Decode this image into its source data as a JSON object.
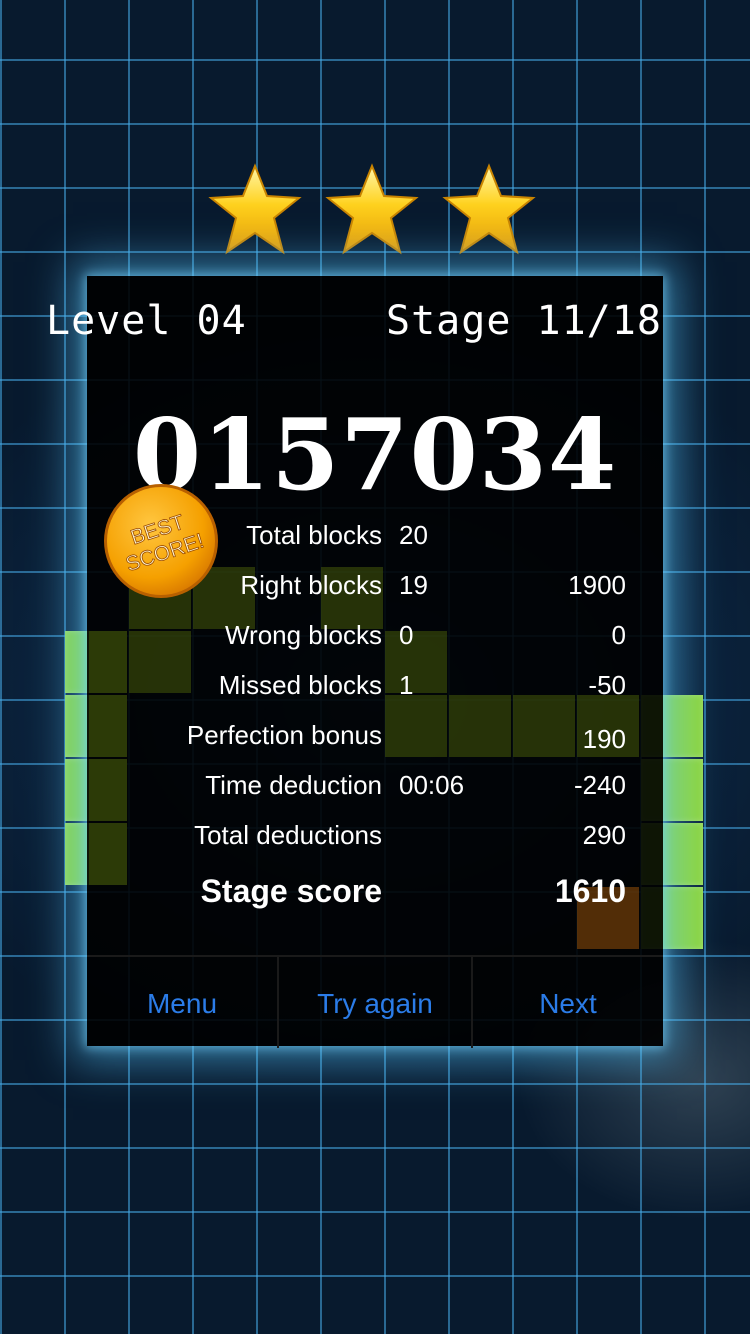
{
  "stars": {
    "earned": 3,
    "total": 3
  },
  "header": {
    "level": "Level 04",
    "stage": "Stage 11/18"
  },
  "score": "0157034",
  "badge": {
    "line1": "BEST",
    "line2": "SCORE!"
  },
  "stats": [
    {
      "label": "Total blocks",
      "value": "20",
      "points": ""
    },
    {
      "label": "Right blocks",
      "value": "19",
      "points": "1900"
    },
    {
      "label": "Wrong blocks",
      "value": "0",
      "points": "0"
    },
    {
      "label": "Missed blocks",
      "value": "1",
      "points": "-50"
    },
    {
      "label": "Perfection bonus",
      "value": "",
      "points": "190"
    },
    {
      "label": "Time deduction",
      "value": "00:06",
      "points": "-240"
    },
    {
      "label": "Total deductions",
      "value": "",
      "points": "290"
    }
  ],
  "stage_score": {
    "label": "Stage score",
    "points": "1610"
  },
  "buttons": {
    "menu": "Menu",
    "try_again": "Try again",
    "next": "Next"
  },
  "colors": {
    "accent": "#2b7ce8",
    "block_green": "#8fd63a",
    "grid": "#46aae6"
  }
}
